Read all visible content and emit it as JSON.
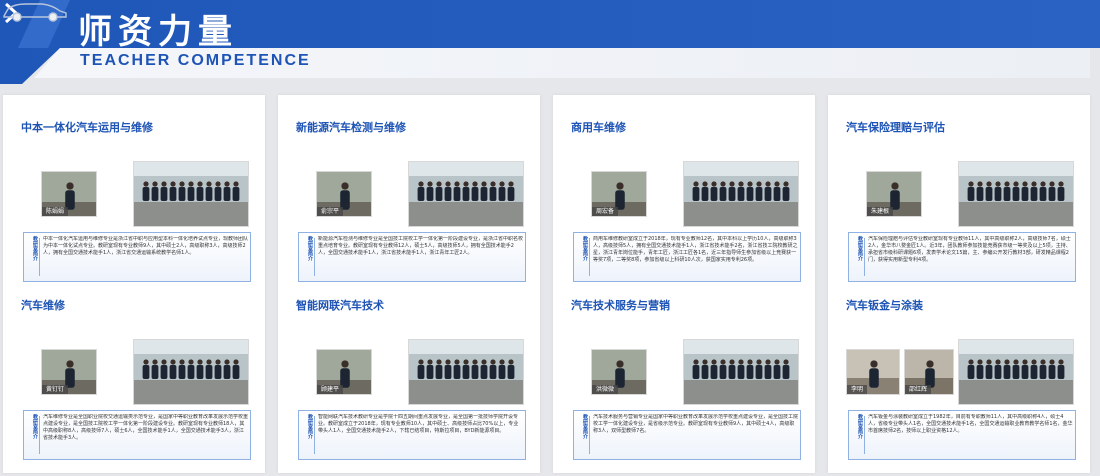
{
  "header": {
    "title_cn": "师资力量",
    "title_en": "TEACHER COMPETENCE",
    "accent": "#1e54b5",
    "icons": [
      "chevron-right-icon",
      "car-icon"
    ]
  },
  "intro_label": "教研室简介",
  "cards": [
    {
      "sections": [
        {
          "title": "中本一体化汽车运用与维修",
          "person": "陈娟娟",
          "text": "中本一体化汽车运用与维修专业是浙江省中职与应用型本科一体化培养试点专业，现教师团队为中本一体化试点专业。教研室现有专业教师9人，其中硕士2人，高级职称3人，高级技师2人，拥有全国交通技术能手1人，浙江省交通运输系统教学名师1人。"
        },
        {
          "title": "汽车维修",
          "person": "黄钉钉",
          "text": "汽车维修专业是全国职业院校交通运输类示范专业，是国家中等职业教育改革发展示范学校重点建设专业，是全国技工院校工学一体化第一阶段建设专业。教研室现有专业教师18人，其中高级职称8人，高级技师7人，硕士6人，全国技术能手1人，全国交通技术能手3人，浙江省技术能手3人。"
        }
      ]
    },
    {
      "sections": [
        {
          "title": "新能源汽车检测与维修",
          "person": "俞宗平",
          "text": "新能源汽车检测与维修专业是全国技工院校工学一体化第一阶段建设专业，是浙江省中职名校重点培育专业。教研室现有专业教师12人，硕士5人，高级技师5人，拥有全国技术能手2人，全国交通技术能手1人，浙江省技术能手1人，浙江青年工匠2人。"
        },
        {
          "title": "智能网联汽车技术",
          "person": "顾建平",
          "text": "智能网联汽车技术教研专业是学院十四五期间重点发展专业，是全国第一批技师学院开设专业。教研室成立于2018年，现有专业教师10人，其中硕士、高级技师占比70%以上，专业带头人1人，全国交通技术能手2人，下辖已结项目，特斯拉项目，BYD新能源项目。"
        }
      ]
    },
    {
      "sections": [
        {
          "title": "商用车维修",
          "person": "周宏备",
          "text": "商用车维修教研室成立于2018年，现有专业教师12名，其中本科以上学历10人，高级职称3人，高级技师5人，拥有全国交通技术能手1人，浙江省技术能手2名，浙江省技工院校教研之星，浙江青年岗位能手，青年工匠，浙江工匠各1名，近三年指导师生参加省级以上竞赛获一等奖7项，二等奖8项，参加省级以上科研10人次，获国家实用专利26项。"
        },
        {
          "title": "汽车技术服务与营销",
          "person": "洪微微",
          "text": "汽车技术服务与营销专业是国家中等职业教育改革发展示范学校重点建设专业，是全国技工院校工学一体化建设专业，是省级示范专业。教研室现有专业教师9人，其中硕士4人，高级职称3人，双师型教师7名。"
        }
      ]
    },
    {
      "sections": [
        {
          "title": "汽车保险理赔与评估",
          "person": "朱建根",
          "text": "汽车保险理赔与评估专业教研室现有专业教师11人，其中高级职称2人，高级技师7名，硕士2人，金华市八婺金匠1人。近3年，团队教师参加技能竞赛获市级一等奖及以上5项，主持、承担省市级科研课题6项，发表学术论文15篇，主、参编公开发行教材3部，研发精品课程2门，获得实用新型专利4项。"
        },
        {
          "title": "汽车钣金与涂装",
          "person": "李明",
          "person2": "邵红辉",
          "text": "汽车钣金与涂装教研室成立于1982年，目前有专职教师11人，其中高级职称4人，硕士4人，省级专业带头人1名，全国交通技术能手1名，全国交通运输职业教育教学名师1名，金华市首席技师2名，技师以上职业资格12人。"
        }
      ]
    }
  ]
}
